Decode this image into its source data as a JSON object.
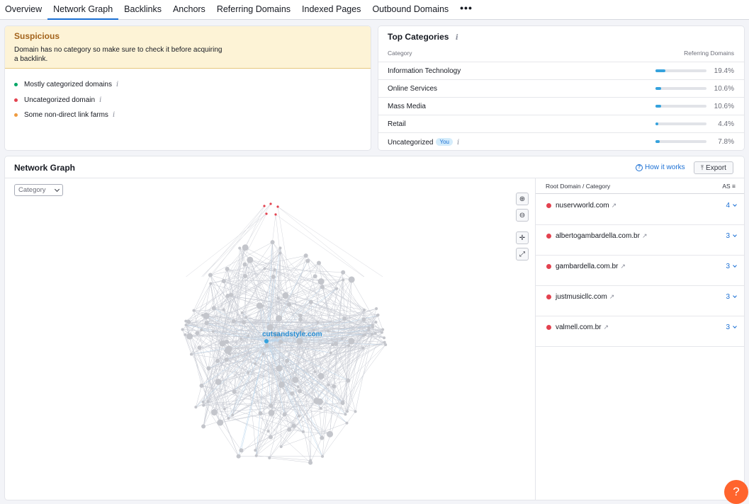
{
  "tabs": [
    "Overview",
    "Network Graph",
    "Backlinks",
    "Anchors",
    "Referring Domains",
    "Indexed Pages",
    "Outbound Domains"
  ],
  "tab_more": "•••",
  "suspicious": {
    "title": "Suspicious",
    "message": "Domain has no category so make sure to check it before acquiring a backlink.",
    "legend": [
      {
        "label": "Mostly categorized domains",
        "color": "#00a666"
      },
      {
        "label": "Uncategorized domain",
        "color": "#e3424f"
      },
      {
        "label": "Some non-direct link farms",
        "color": "#ee9b40"
      }
    ]
  },
  "top_categories": {
    "title": "Top Categories",
    "col_category": "Category",
    "col_ref": "Referring Domains",
    "you_badge": "You",
    "rows": [
      {
        "name": "Information Technology",
        "pct": "19.4%",
        "share": 0.194
      },
      {
        "name": "Online Services",
        "pct": "10.6%",
        "share": 0.106
      },
      {
        "name": "Mass Media",
        "pct": "10.6%",
        "share": 0.106
      },
      {
        "name": "Retail",
        "pct": "4.4%",
        "share": 0.044
      },
      {
        "name": "Uncategorized",
        "pct": "7.8%",
        "share": 0.078
      }
    ]
  },
  "network": {
    "title": "Network Graph",
    "how_it_works": "How it works",
    "export": "Export",
    "category_select": "Category",
    "center_label": "cutsandstyle.com",
    "side_head": "Root Domain / Category",
    "side_as": "AS",
    "domains": [
      {
        "name": "nuservworld.com",
        "as": "4"
      },
      {
        "name": "albertogambardella.com.br",
        "as": "3"
      },
      {
        "name": "gambardella.com.br",
        "as": "3"
      },
      {
        "name": "justmusicllc.com",
        "as": "3"
      },
      {
        "name": "valmell.com.br",
        "as": "3"
      }
    ]
  },
  "help": "?"
}
